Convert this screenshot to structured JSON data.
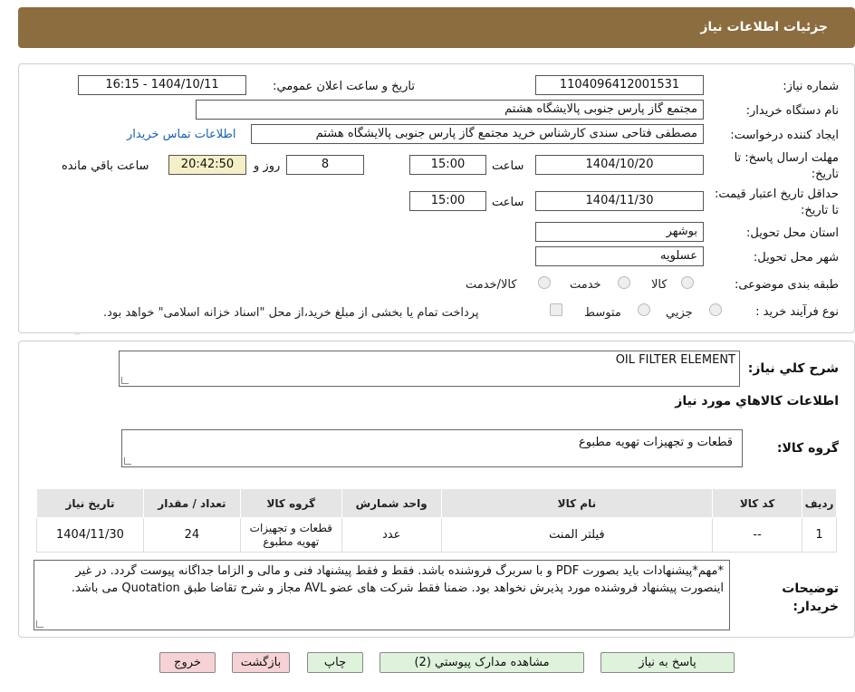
{
  "header": {
    "title": "جزئیات اطلاعات نیاز"
  },
  "form": {
    "need_number_label": "شماره نیاز:",
    "need_number": "1104096412001531",
    "announce_label": "تاریخ و ساعت اعلان عمومي:",
    "announce_value": "1404/10/11 - 16:15",
    "buyer_label": "نام دستگاه خريدار:",
    "buyer_value": "مجتمع گاز پارس جنوبی  پالایشگاه هشتم",
    "requester_label": "ایجاد کننده درخواست:",
    "requester_value": "مصطفی فتاحی سندی کارشناس خرید مجتمع گاز پارس جنوبی  پالایشگاه هشتم",
    "contact_link": "اطلاعات تماس خریدار",
    "send_deadline_label": "مهلت ارسال پاسخ: تا تاریخ:",
    "send_date": "1404/10/20",
    "time_label": "ساعت",
    "send_time": "15:00",
    "days_value": "8",
    "days_label": "روز و",
    "remaining_time": "20:42:50",
    "remaining_label": "ساعت باقي مانده",
    "price_validity_label": "حداقل تاريخ اعتبار قیمت: تا تاریخ:",
    "price_date": "1404/11/30",
    "price_time": "15:00",
    "province_label": "استان محل تحويل:",
    "province_value": "بوشهر",
    "city_label": "شهر محل تحويل:",
    "city_value": "عسلویه",
    "category_label": "طبقه بندی موضوعی:",
    "category_options": [
      "کالا",
      "خدمت",
      "کالا/خدمت"
    ],
    "process_label": "نوع فرآیند خرید :",
    "process_options": [
      "جزیي",
      "متوسط"
    ],
    "payment_text": "پرداخت تمام یا بخشی از مبلغ خرید،از محل \"اسناد خزانه اسلامی\" خواهد بود."
  },
  "description": {
    "summary_label": "شرح کلي نياز:",
    "summary_value": "OIL FILTER ELEMENT",
    "goods_info_title": "اطلاعات کالاهاي مورد نياز",
    "group_label": "گروه کالا:",
    "group_value": "قطعات و تجهیزات تهویه مطبوع"
  },
  "table": {
    "headers": [
      "رديف",
      "کد کالا",
      "نام کالا",
      "واحد شمارش",
      "گروه کالا",
      "تعداد / مقدار",
      "تاريخ نياز"
    ],
    "rows": [
      [
        "1",
        "--",
        "فیلتر المنت",
        "عدد",
        "قطعات و تجهیزات تهویه مطبوع",
        "24",
        "1404/11/30"
      ]
    ]
  },
  "notes": {
    "label": "توضيحات خريدار:",
    "text": "*مهم*پیشنهادات باید بصورت PDF و با سربرگ فروشنده باشد. فقط و فقط پیشنهاد فنی و مالی و الزاما جداگانه پیوست گردد. در غیر اینصورت پیشنهاد فروشنده مورد پذیرش نخواهد بود. ضمنا فقط شرکت های عضو AVL مجاز و شرح تقاضا طبق Quotation می باشد."
  },
  "buttons": {
    "reply": "پاسخ به نياز",
    "attachments": "مشاهده مدارک پیوستي (2)",
    "print": "چاپ",
    "back": "بازگشت",
    "exit": "خروج"
  },
  "watermark": {
    "text": "AriaTender.neT"
  },
  "colors": {
    "header": "#8c6d3f",
    "link": "#1a5fb4",
    "remaining_bg": "#f5efc7",
    "green_btn": "#dff3dc",
    "red_btn": "#f6d2d5"
  }
}
